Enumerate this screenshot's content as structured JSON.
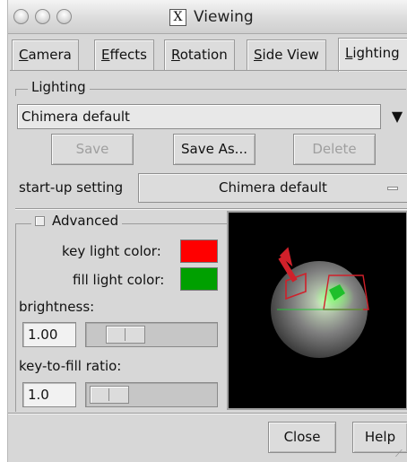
{
  "window": {
    "title": "Viewing",
    "title_icon": "X"
  },
  "tabs": [
    {
      "label_first": "C",
      "label_rest": "amera"
    },
    {
      "label_first": "E",
      "label_rest": "ffects"
    },
    {
      "label_first": "R",
      "label_rest": "otation"
    },
    {
      "label_first": "S",
      "label_rest": "ide View"
    },
    {
      "label_first": "L",
      "label_rest": "ighting",
      "active": true
    }
  ],
  "lighting": {
    "group_label": "Lighting",
    "preset_value": "Chimera default",
    "preset_arrow": "▼",
    "save_label": "Save",
    "save_as_label": "Save As...",
    "delete_label": "Delete",
    "startup_label": "start-up setting",
    "startup_value": "Chimera default"
  },
  "advanced": {
    "label": "Advanced",
    "checked": false,
    "key_light_label": "key light color:",
    "key_light_color": "#ff0000",
    "fill_light_label": "fill light color:",
    "fill_light_color": "#00a000",
    "brightness_label": "brightness:",
    "brightness_value": "1.00",
    "key_to_fill_label": "key-to-fill ratio:",
    "key_to_fill_value": "1.0"
  },
  "footer": {
    "close_label": "Close",
    "help_label": "Help"
  },
  "icons": {
    "close": "traffic-light-close-icon",
    "minimize": "traffic-light-minimize-icon",
    "zoom": "traffic-light-zoom-icon",
    "dropdown": "triangle-down-icon",
    "checkbox": "checkbox-icon",
    "option_menu": "option-menu-indicator-icon"
  },
  "colors": {
    "window_bg": "#d7d7d7",
    "preview_bg": "#000000"
  }
}
